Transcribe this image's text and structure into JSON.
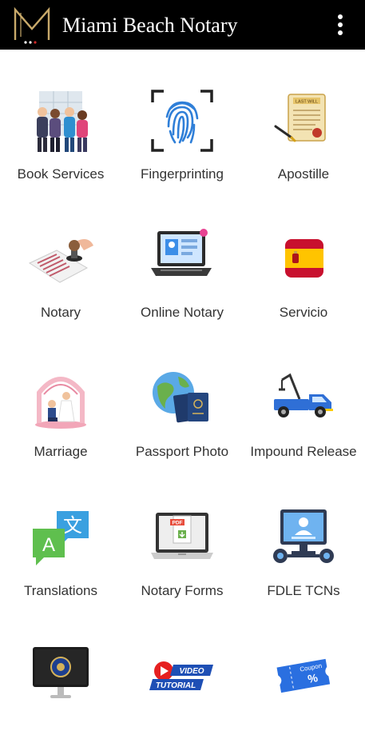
{
  "app": {
    "title": "Miami Beach Notary"
  },
  "colors": {
    "appbar": "#000000",
    "logo_gold": "#c8a96a",
    "label": "#333333"
  },
  "services": [
    {
      "label": "Book Services",
      "icon": "people-icon"
    },
    {
      "label": "Fingerprinting",
      "icon": "fingerprint-icon"
    },
    {
      "label": "Apostille",
      "icon": "certificate-icon"
    },
    {
      "label": "Notary",
      "icon": "stamp-icon"
    },
    {
      "label": "Online Notary",
      "icon": "laptop-icon"
    },
    {
      "label": "Servicio",
      "icon": "spain-flag-icon"
    },
    {
      "label": "Marriage",
      "icon": "wedding-icon"
    },
    {
      "label": "Passport Photo",
      "icon": "passport-icon"
    },
    {
      "label": "Impound Release",
      "icon": "tow-truck-icon"
    },
    {
      "label": "Translations",
      "icon": "translate-icon"
    },
    {
      "label": "Notary Forms",
      "icon": "pdf-form-icon"
    },
    {
      "label": "FDLE TCNs",
      "icon": "monitor-profile-icon"
    },
    {
      "label": "",
      "icon": "fbi-monitor-icon"
    },
    {
      "label": "",
      "icon": "video-tutorial-icon",
      "icon_text": [
        "VIDEO",
        "TUTORIAL"
      ]
    },
    {
      "label": "",
      "icon": "coupon-icon",
      "icon_text": [
        "Coupon"
      ]
    }
  ],
  "misc": {
    "apostille_doc_title": "LAST WILL",
    "pdf_badge": "PDF"
  }
}
